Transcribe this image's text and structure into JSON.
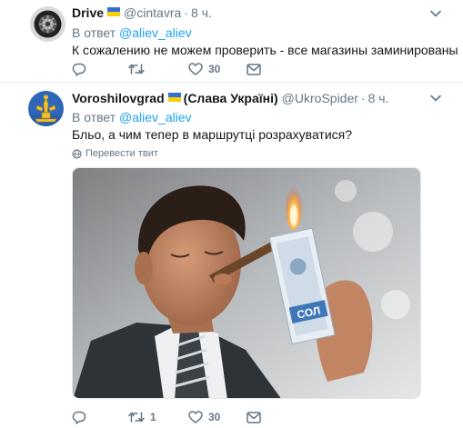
{
  "tweets": [
    {
      "name": "Drive",
      "handle": "@cintavra",
      "separator": "·",
      "time": "8 ч.",
      "reply_prefix": "В ответ",
      "reply_handle": "@aliev_aliev",
      "text": "К сожалению не можем проверить - все магазины заминированы",
      "retweets": "",
      "likes": "30"
    },
    {
      "name": "Voroshilovgrad",
      "name_suffix": "(Слава Україні)",
      "handle": "@UkroSpider",
      "separator": "·",
      "time": "8 ч.",
      "reply_prefix": "В ответ",
      "reply_handle": "@aliev_aliev",
      "text": "Бльо, а чим тепер в маршрутці розрахуватися?",
      "translate_label": "Перевести твит",
      "media_text": "СОЛ",
      "retweets": "1",
      "likes": "30"
    }
  ],
  "colors": {
    "link": "#1da1f2",
    "secondary": "#657786",
    "primary_text": "#14171a",
    "flag_blue": "#2f6fd6",
    "flag_yellow": "#f6d000"
  },
  "icons": [
    "reply-icon",
    "retweet-icon",
    "like-icon",
    "direct-message-icon",
    "chevron-down-icon",
    "globe-icon"
  ]
}
